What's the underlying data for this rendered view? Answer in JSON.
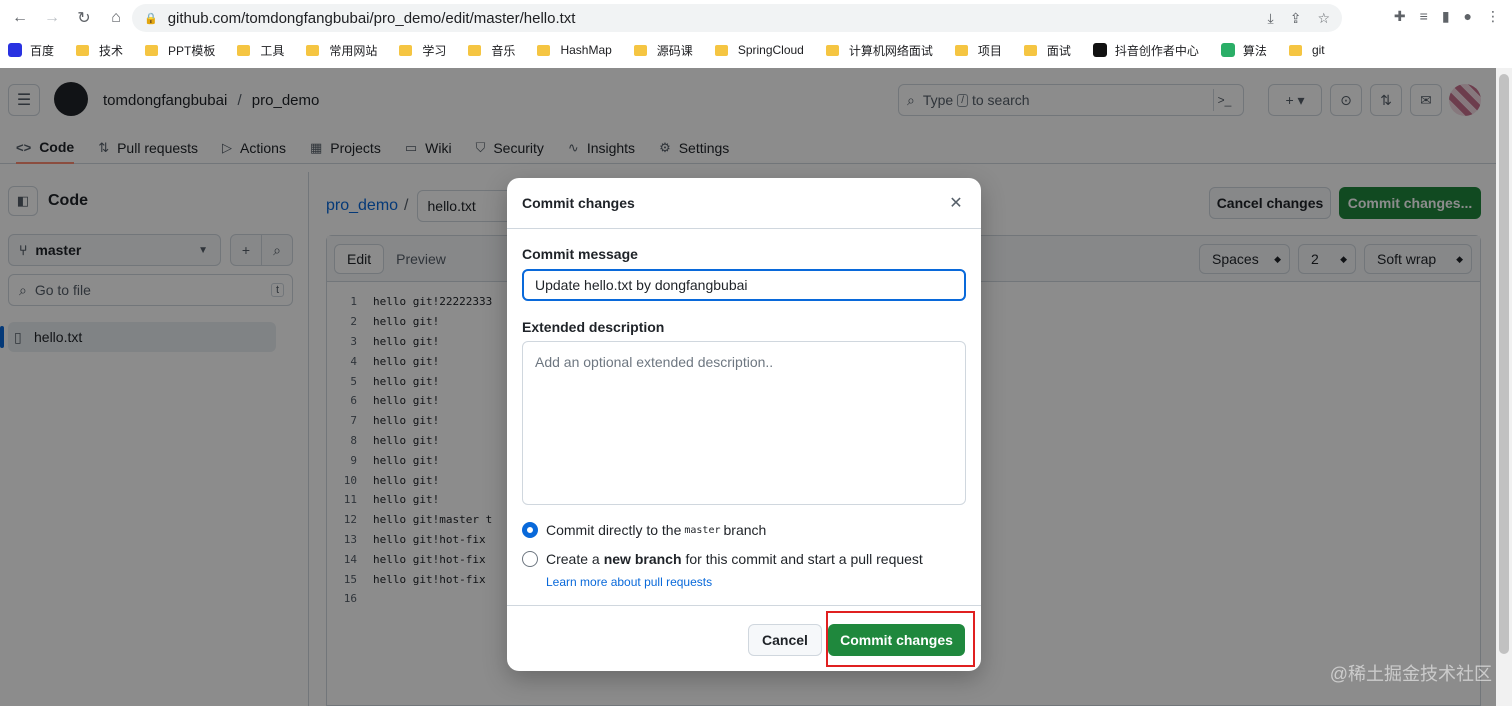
{
  "browser": {
    "url": "github.com/tomdongfangbubai/pro_demo/edit/master/hello.txt",
    "bookmarks": [
      {
        "label": "百度",
        "icon": "baidu-icon"
      },
      {
        "label": "技术",
        "icon": "folder-icon"
      },
      {
        "label": "PPT模板",
        "icon": "folder-icon"
      },
      {
        "label": "工具",
        "icon": "folder-icon"
      },
      {
        "label": "常用网站",
        "icon": "folder-icon"
      },
      {
        "label": "学习",
        "icon": "folder-icon"
      },
      {
        "label": "音乐",
        "icon": "folder-icon"
      },
      {
        "label": "HashMap",
        "icon": "folder-icon"
      },
      {
        "label": "源码课",
        "icon": "folder-icon"
      },
      {
        "label": "SpringCloud",
        "icon": "folder-icon"
      },
      {
        "label": "计算机网络面试",
        "icon": "folder-icon"
      },
      {
        "label": "项目",
        "icon": "folder-icon"
      },
      {
        "label": "面试",
        "icon": "folder-icon"
      },
      {
        "label": "抖音创作者中心",
        "icon": "tiktok-icon"
      },
      {
        "label": "算法",
        "icon": "wechat-icon"
      },
      {
        "label": "git",
        "icon": "folder-icon"
      }
    ]
  },
  "header": {
    "owner": "tomdongfangbubai",
    "separator": "/",
    "repo": "pro_demo",
    "search_prefix": "Type",
    "search_key": "/",
    "search_suffix": "to search"
  },
  "repo_nav": {
    "tabs": [
      {
        "label": "Code",
        "icon": "code-icon",
        "active": true
      },
      {
        "label": "Pull requests",
        "icon": "pull-request-icon"
      },
      {
        "label": "Actions",
        "icon": "play-icon"
      },
      {
        "label": "Projects",
        "icon": "table-icon"
      },
      {
        "label": "Wiki",
        "icon": "book-icon"
      },
      {
        "label": "Security",
        "icon": "shield-icon"
      },
      {
        "label": "Insights",
        "icon": "graph-icon"
      },
      {
        "label": "Settings",
        "icon": "gear-icon"
      }
    ]
  },
  "file_tree": {
    "title": "Code",
    "branch": "master",
    "goto_placeholder": "Go to file",
    "goto_key": "t",
    "files": [
      "hello.txt"
    ]
  },
  "editor": {
    "breadcrumb_repo": "pro_demo",
    "breadcrumb_sep": "/",
    "filename": "hello.txt",
    "cancel_label": "Cancel changes",
    "commit_label": "Commit changes...",
    "mode_edit": "Edit",
    "mode_preview": "Preview",
    "indent_mode": "Spaces",
    "indent_size": "2",
    "wrap_mode": "Soft wrap",
    "lines": [
      {
        "n": "1",
        "text": "hello git!22222333"
      },
      {
        "n": "2",
        "text": "hello git!"
      },
      {
        "n": "3",
        "text": "hello git!"
      },
      {
        "n": "4",
        "text": "hello git!"
      },
      {
        "n": "5",
        "text": "hello git!"
      },
      {
        "n": "6",
        "text": "hello git!"
      },
      {
        "n": "7",
        "text": "hello git!"
      },
      {
        "n": "8",
        "text": "hello git!"
      },
      {
        "n": "9",
        "text": "hello git!"
      },
      {
        "n": "10",
        "text": "hello git!"
      },
      {
        "n": "11",
        "text": "hello git!"
      },
      {
        "n": "12",
        "text": "hello git!master t"
      },
      {
        "n": "13",
        "text": "hello git!hot-fix"
      },
      {
        "n": "14",
        "text": "hello git!hot-fix"
      },
      {
        "n": "15",
        "text": "hello git!hot-fix"
      },
      {
        "n": "16",
        "text": ""
      }
    ]
  },
  "dialog": {
    "title": "Commit changes",
    "message_label": "Commit message",
    "message_value": "Update hello.txt by dongfangbubai",
    "desc_label": "Extended description",
    "desc_placeholder": "Add an optional extended description..",
    "option1_prefix": "Commit directly to the",
    "option1_branch": "master",
    "option1_suffix": "branch",
    "option2_prefix": "Create a",
    "option2_bold": "new branch",
    "option2_suffix": "for this commit and start a pull request",
    "learn_more": "Learn more about pull requests",
    "cancel_label": "Cancel",
    "commit_label": "Commit changes"
  },
  "watermark": "@稀土掘金技术社区",
  "colors": {
    "accent": "#0969da",
    "commit_green": "#1f883d",
    "highlight": "#e02020"
  }
}
